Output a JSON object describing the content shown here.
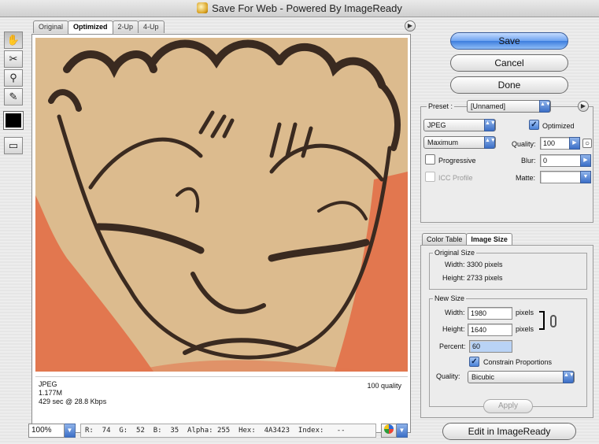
{
  "window": {
    "title": "Save For Web - Powered By ImageReady"
  },
  "tabs": [
    {
      "label": "Original",
      "active": false
    },
    {
      "label": "Optimized",
      "active": true
    },
    {
      "label": "2-Up",
      "active": false
    },
    {
      "label": "4-Up",
      "active": false
    }
  ],
  "toolbox": {
    "tools": [
      {
        "name": "hand-tool-icon",
        "glyph": "✋"
      },
      {
        "name": "slice-select-tool-icon",
        "glyph": "✂"
      },
      {
        "name": "zoom-tool-icon",
        "glyph": "🔍"
      },
      {
        "name": "eyedropper-tool-icon",
        "glyph": "✎"
      }
    ],
    "swatch_color": "#000000",
    "preview_glyph": "▭"
  },
  "image_info": {
    "format": "JPEG",
    "size": "1.177M",
    "download_time": "429 sec @ 28.8 Kbps",
    "quality_text": "100 quality"
  },
  "status": {
    "zoom": "100%",
    "readout": "R:  74  G:  52  B:  35  Alpha: 255  Hex:  4A3423  Index:   --"
  },
  "buttons": {
    "save": "Save",
    "cancel": "Cancel",
    "done": "Done",
    "apply": "Apply",
    "edit_in_imageready": "Edit in ImageReady"
  },
  "settings": {
    "preset_label": "Preset :",
    "preset_value": "[Unnamed]",
    "format_value": "JPEG",
    "compression_value": "Maximum",
    "optimized_label": "Optimized",
    "optimized_checked": true,
    "quality_label": "Quality:",
    "quality_value": "100",
    "progressive_label": "Progressive",
    "progressive_checked": false,
    "blur_label": "Blur:",
    "blur_value": "0",
    "icc_label": "ICC Profile",
    "icc_checked": false,
    "matte_label": "Matte:"
  },
  "sub_tabs": [
    {
      "label": "Color Table",
      "active": false
    },
    {
      "label": "Image Size",
      "active": true
    }
  ],
  "image_size": {
    "original_title": "Original Size",
    "original_width": "Width: 3300 pixels",
    "original_height": "Height: 2733 pixels",
    "new_title": "New Size",
    "width_label": "Width:",
    "width_value": "1980",
    "height_label": "Height:",
    "height_value": "1640",
    "unit": "pixels",
    "percent_label": "Percent:",
    "percent_value": "60",
    "constrain_label": "Constrain Proportions",
    "constrain_checked": true,
    "quality_label": "Quality:",
    "quality_value": "Bicubic"
  },
  "colors": {
    "accent": "#3d7ede",
    "skin": "#d9b68a",
    "background_orange": "#e2774f",
    "ink": "#3a2a20"
  }
}
